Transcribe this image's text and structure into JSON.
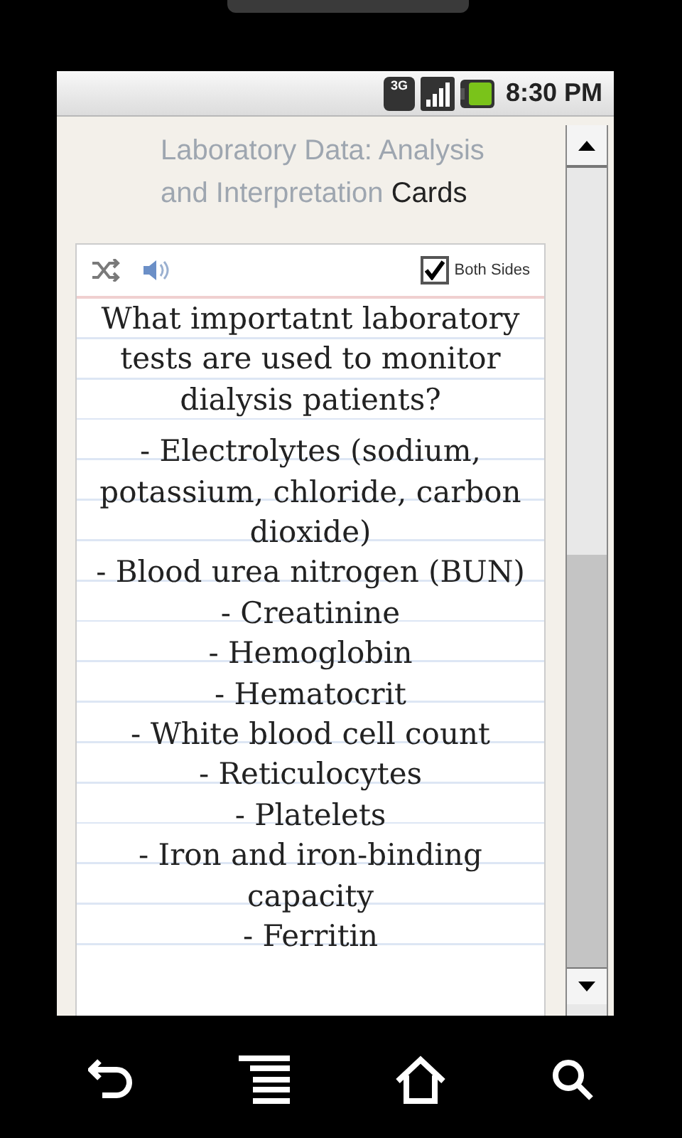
{
  "status_bar": {
    "network": "3G",
    "time": "8:30 PM"
  },
  "header": {
    "title": "Laboratory Data: Analysis and Interpretation",
    "suffix": "Cards"
  },
  "card": {
    "both_sides": {
      "label": "Both Sides",
      "checked": true
    },
    "question": "What importatnt laboratory tests are used to monitor dialysis patients?",
    "answer_lines": [
      "- Electrolytes (sodium, potassium, chloride, carbon dioxide)",
      "- Blood urea nitrogen (BUN)",
      "- Creatinine",
      "- Hemoglobin",
      "- Hematocrit",
      "- White blood cell count",
      "- Reticulocytes",
      "- Platelets",
      "- Iron and iron-binding capacity",
      "- Ferritin"
    ]
  }
}
